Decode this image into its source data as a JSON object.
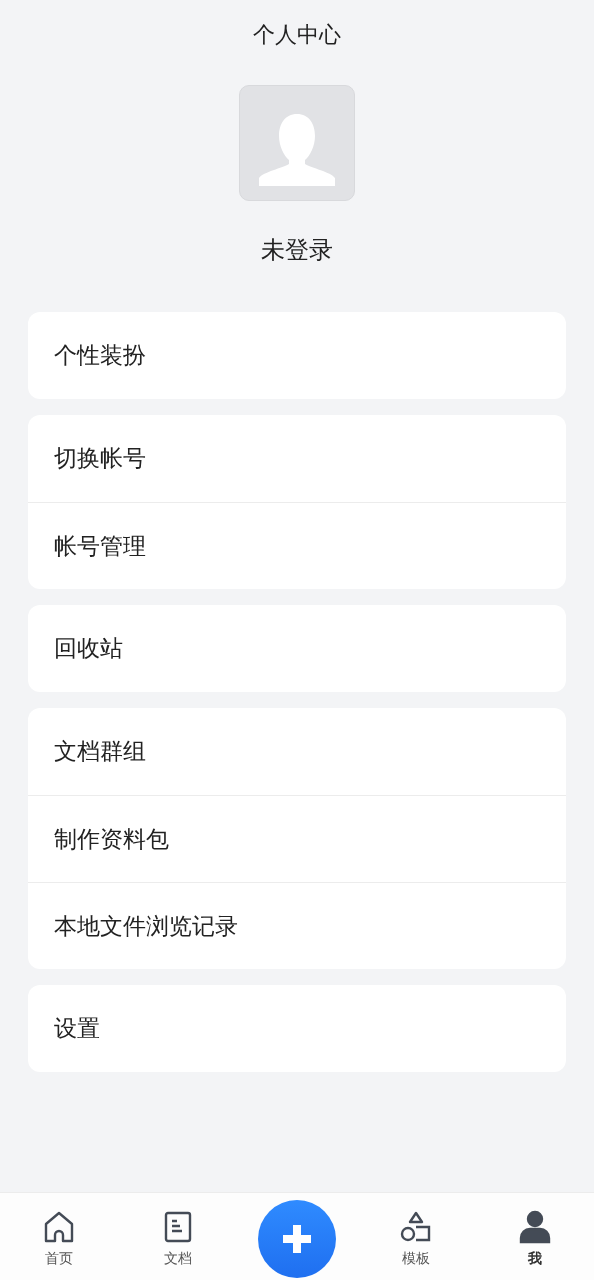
{
  "header": {
    "title": "个人中心"
  },
  "profile": {
    "name": "未登录"
  },
  "menu_groups": [
    {
      "items": [
        "个性装扮"
      ]
    },
    {
      "items": [
        "切换帐号",
        "帐号管理"
      ]
    },
    {
      "items": [
        "回收站"
      ]
    },
    {
      "items": [
        "文档群组",
        "制作资料包",
        "本地文件浏览记录"
      ]
    },
    {
      "items": [
        "设置"
      ]
    }
  ],
  "tab_bar": [
    {
      "kind": "home",
      "label": "首页",
      "selected": false
    },
    {
      "kind": "docs",
      "label": "文档",
      "selected": false
    },
    {
      "kind": "add"
    },
    {
      "kind": "templates",
      "label": "模板",
      "selected": false
    },
    {
      "kind": "me",
      "label": "我",
      "selected": true
    }
  ]
}
